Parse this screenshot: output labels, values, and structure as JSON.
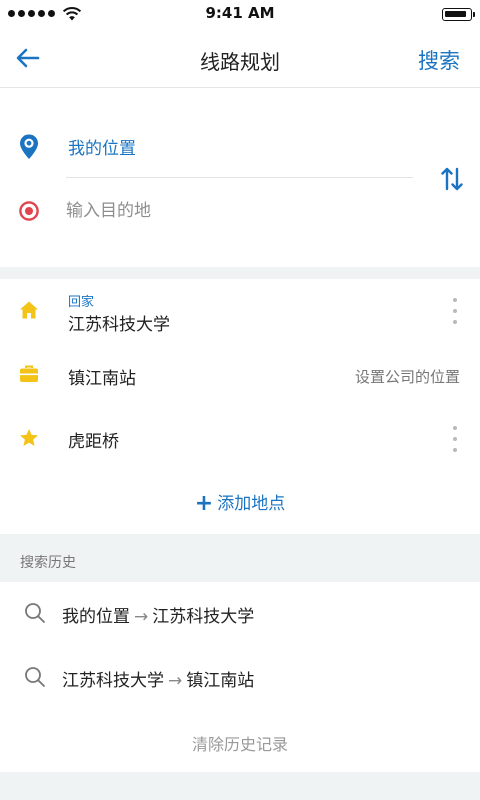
{
  "status_bar": {
    "time": "9:41 AM"
  },
  "nav": {
    "title": "线路规划",
    "search_label": "搜索"
  },
  "route": {
    "origin": "我的位置",
    "destination_placeholder": "输入目的地"
  },
  "places": {
    "home": {
      "label": "回家",
      "name": "江苏科技大学"
    },
    "work": {
      "name": "镇江南站",
      "hint": "设置公司的位置"
    },
    "favorite": {
      "name": "虎距桥"
    },
    "add_label": "添加地点"
  },
  "history": {
    "title": "搜索历史",
    "items": [
      {
        "from": "我的位置",
        "arrow": "→",
        "to": "江苏科技大学"
      },
      {
        "from": "江苏科技大学",
        "arrow": "→",
        "to": "镇江南站"
      }
    ],
    "clear_label": "清除历史记录"
  },
  "colors": {
    "accent": "#1b74c2",
    "destination_marker": "#e0454e",
    "place_icon": "#f3c318",
    "section_background": "#f0f3f4"
  },
  "icons": {
    "back": "arrow-left-icon",
    "origin": "location-pin-icon",
    "destination": "target-icon",
    "swap": "swap-vertical-icon",
    "home": "home-icon",
    "work": "briefcase-icon",
    "favorite": "star-icon",
    "more": "more-vertical-icon",
    "history": "search-icon"
  }
}
